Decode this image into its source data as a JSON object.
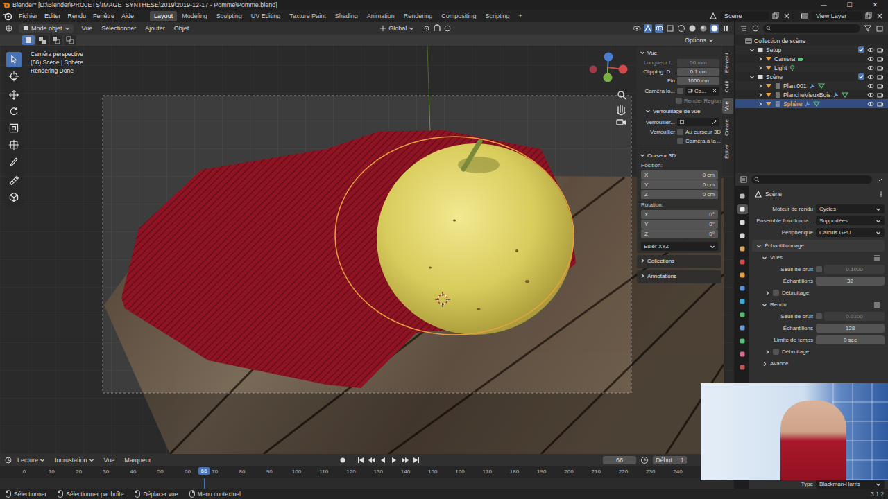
{
  "window": {
    "title": "Blender* [D:\\Blender\\PROJETS\\IMAGE_SYNTHESE\\2019\\2019-12-17 - Pomme\\Pomme.blend]",
    "controls": [
      "—",
      "☐",
      "✕"
    ]
  },
  "topbar": {
    "menus": [
      "Fichier",
      "Editer",
      "Rendu",
      "Fenêtre",
      "Aide"
    ],
    "workspaces": [
      {
        "label": "Layout",
        "selected": true
      },
      {
        "label": "Modeling",
        "selected": false
      },
      {
        "label": "Sculpting",
        "selected": false
      },
      {
        "label": "UV Editing",
        "selected": false
      },
      {
        "label": "Texture Paint",
        "selected": false
      },
      {
        "label": "Shading",
        "selected": false
      },
      {
        "label": "Animation",
        "selected": false
      },
      {
        "label": "Rendering",
        "selected": false
      },
      {
        "label": "Compositing",
        "selected": false
      },
      {
        "label": "Scripting",
        "selected": false
      }
    ],
    "add_workspace": "+",
    "scene": "Scene",
    "view_layer": "View Layer"
  },
  "viewport": {
    "header": {
      "mode": "Mode objet",
      "menus": [
        "Vue",
        "Sélectionner",
        "Ajouter",
        "Objet"
      ],
      "orientation": "Global",
      "options": "Options"
    },
    "overlay_text": [
      "Caméra perspective",
      "(66) Scène | Sphère",
      "Rendering Done"
    ],
    "tools": [
      {
        "selected": true
      },
      {
        "selected": false
      },
      {
        "selected": false
      },
      {
        "selected": false
      },
      {
        "selected": false
      },
      {
        "selected": false
      },
      {
        "selected": false
      },
      {
        "selected": false
      },
      {
        "selected": false
      }
    ],
    "sidebar_tabs": [
      {
        "label": "Élément",
        "selected": false
      },
      {
        "label": "Outil",
        "selected": false
      },
      {
        "label": "Vue",
        "selected": true
      },
      {
        "label": "Create",
        "selected": false
      },
      {
        "label": "Éditer",
        "selected": false
      }
    ],
    "sidebar": {
      "view": {
        "title": "Vue",
        "expanded": true,
        "fields": [
          {
            "label": "Longueur f...",
            "value": "50 mm",
            "disabled": true
          },
          {
            "label": "Clipping: D...",
            "value": "0.1 cm",
            "disabled": false
          },
          {
            "label": "Fin",
            "value": "1000 cm",
            "disabled": false
          }
        ],
        "camera_lock": {
          "label": "Caméra lo...",
          "value": "Ca..."
        },
        "render_region": {
          "label": "Render Region",
          "checked": false,
          "disabled": true
        },
        "lock": {
          "title": "Verrouillage de vue",
          "expanded": true,
          "object_label": "Verrouiller...",
          "label": "Verrouiller",
          "options": [
            {
              "label": "Au curseur 3D",
              "checked": false
            },
            {
              "label": "Caméra à la ...",
              "checked": false
            }
          ]
        }
      },
      "cursor": {
        "title": "Curseur 3D",
        "expanded": true,
        "position_label": "Position:",
        "position": [
          {
            "axis": "X",
            "value": "0 cm"
          },
          {
            "axis": "Y",
            "value": "0 cm"
          },
          {
            "axis": "Z",
            "value": "0 cm"
          }
        ],
        "rotation_label": "Rotation:",
        "rotation": [
          {
            "axis": "X",
            "value": "0°"
          },
          {
            "axis": "Y",
            "value": "0°"
          },
          {
            "axis": "Z",
            "value": "0°"
          }
        ],
        "rotation_mode": "Euler XYZ"
      },
      "collapsed": [
        {
          "title": "Collections",
          "expanded": false
        },
        {
          "title": "Annotations",
          "expanded": false
        }
      ]
    }
  },
  "outliner": {
    "root": "Collection de scène",
    "collections": [
      {
        "label": "Setup",
        "expanded": true,
        "checked": true,
        "objects": [
          {
            "label": "Camera",
            "kind": "camera",
            "selected": false,
            "expanded": false
          },
          {
            "label": "Light",
            "kind": "light",
            "selected": false,
            "expanded": false
          }
        ]
      },
      {
        "label": "Scène",
        "expanded": true,
        "checked": true,
        "objects": [
          {
            "label": "Plan.001",
            "kind": "mesh",
            "selected": false,
            "expanded": false
          },
          {
            "label": "PlancheVieuxBois",
            "kind": "mesh",
            "selected": false,
            "expanded": false
          },
          {
            "label": "Sphère",
            "kind": "mesh",
            "selected": true,
            "expanded": false
          }
        ]
      }
    ]
  },
  "properties": {
    "context": "Scène",
    "tabs": [
      {
        "selected": false
      },
      {
        "selected": true
      },
      {
        "selected": false
      },
      {
        "selected": false
      },
      {
        "selected": false
      },
      {
        "selected": false
      },
      {
        "selected": false
      },
      {
        "selected": false
      },
      {
        "selected": false
      },
      {
        "selected": false
      },
      {
        "selected": false
      },
      {
        "selected": false
      },
      {
        "selected": false
      },
      {
        "selected": false
      }
    ],
    "rows": [
      {
        "kind": "dropdown",
        "label": "Moteur de rendu",
        "value": "Cycles"
      },
      {
        "kind": "dropdown",
        "label": "Ensemble fonctionna...",
        "value": "Supportées"
      },
      {
        "kind": "dropdown",
        "label": "Périphérique",
        "value": "Calculs GPU"
      },
      {
        "kind": "panel",
        "label": "Échantillonnage",
        "expanded": true
      },
      {
        "kind": "subpanel",
        "label": "Vues",
        "expanded": true
      },
      {
        "kind": "threshold",
        "label": "Seuil de bruit",
        "value": "0.1000",
        "checked": false
      },
      {
        "kind": "number",
        "label": "Échantillons",
        "value": "32"
      },
      {
        "kind": "option",
        "label": "Débruitage",
        "expanded": false,
        "checked": false
      },
      {
        "kind": "subpanel",
        "label": "Rendu",
        "expanded": true
      },
      {
        "kind": "threshold",
        "label": "Seuil de bruit",
        "value": "0.0100",
        "checked": false
      },
      {
        "kind": "number",
        "label": "Échantillons",
        "value": "128"
      },
      {
        "kind": "number",
        "label": "Limite de temps",
        "value": "0 sec"
      },
      {
        "kind": "option",
        "label": "Débruitage",
        "expanded": false,
        "checked": false
      },
      {
        "kind": "subpanel",
        "label": "Avancé",
        "expanded": false
      }
    ],
    "footer_row": {
      "label": "Type",
      "value": "Blackman-Harris"
    }
  },
  "timeline": {
    "menus": [
      {
        "label": "Lecture",
        "kind": "dropdown"
      },
      {
        "label": "Incrustation",
        "kind": "dropdown"
      },
      {
        "label": "Vue",
        "kind": "menu"
      },
      {
        "label": "Marqueur",
        "kind": "menu"
      }
    ],
    "current_frame": "66",
    "start_label": "Début",
    "start": "1",
    "ticks": [
      "0",
      "10",
      "20",
      "30",
      "40",
      "50",
      "60",
      "70",
      "80",
      "90",
      "100",
      "110",
      "120",
      "130",
      "140",
      "150",
      "160",
      "170",
      "180",
      "190",
      "200",
      "210",
      "220",
      "230",
      "240"
    ],
    "playhead": "66"
  },
  "status_bar": {
    "hints": [
      "Sélectionner",
      "Sélectionner par boîte",
      "Déplacer vue",
      "Menu contextuel"
    ],
    "version": "3.1.2"
  }
}
